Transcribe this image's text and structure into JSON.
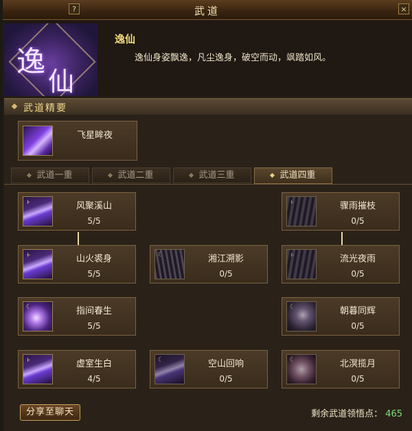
{
  "window": {
    "title": "武道",
    "help_label": "?",
    "close_label": "×"
  },
  "path": {
    "emblem_char1": "逸",
    "emblem_char2": "仙",
    "name": "逸仙",
    "description": "逸仙身姿飘逸，凡尘逸身，破空而动，飒踏如风。"
  },
  "essence": {
    "section_title": "武道精要",
    "skill": {
      "name": "飞星眸夜",
      "icon": "purple-leap-icon"
    }
  },
  "tabs": [
    {
      "label": "武道一重",
      "active": false
    },
    {
      "label": "武道二重",
      "active": false
    },
    {
      "label": "武道三重",
      "active": false
    },
    {
      "label": "武道四重",
      "active": true
    }
  ],
  "skills": [
    {
      "name": "风聚溪山",
      "rank": "5/5",
      "icon": "purple-slash-icon"
    },
    {
      "name": "骤雨摧枝",
      "rank": "0/5",
      "icon": "rain-icon"
    },
    {
      "name": "山火裘身",
      "rank": "5/5",
      "icon": "purple-slash-icon"
    },
    {
      "name": "湘江溯影",
      "rank": "0/5",
      "icon": "wave-icon"
    },
    {
      "name": "流光夜雨",
      "rank": "0/5",
      "icon": "rain-icon"
    },
    {
      "name": "指间春生",
      "rank": "5/5",
      "icon": "purple-orb-icon"
    },
    {
      "name": "朝暮同辉",
      "rank": "0/5",
      "icon": "moon-icon"
    },
    {
      "name": "虚室生白",
      "rank": "4/5",
      "icon": "purple-slash-icon"
    },
    {
      "name": "空山回响",
      "rank": "0/5",
      "icon": "echo-icon"
    },
    {
      "name": "北溟揽月",
      "rank": "0/5",
      "icon": "swirl-icon"
    }
  ],
  "footer": {
    "share_label": "分享至聊天",
    "points_label": "剩余武道领悟点：",
    "points_value": "465"
  },
  "colors": {
    "accent": "#f2da7c",
    "points_green": "#7fe07a"
  }
}
